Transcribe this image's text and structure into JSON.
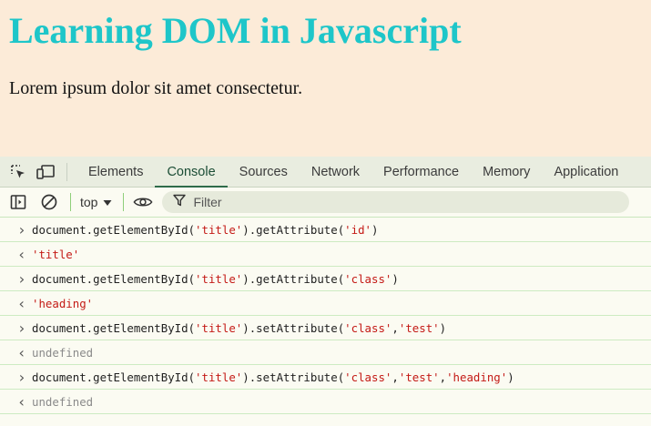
{
  "page": {
    "heading": "Learning DOM in Javascript",
    "paragraph": "Lorem ipsum dolor sit amet consectetur."
  },
  "devtools": {
    "tabs": [
      "Elements",
      "Console",
      "Sources",
      "Network",
      "Performance",
      "Memory",
      "Application"
    ],
    "active_tab": "Console",
    "context_label": "top",
    "filter_placeholder": "Filter",
    "icons": {
      "inspect": "inspect-element-icon",
      "device": "device-toolbar-icon",
      "sidebar": "sidebar-toggle-icon",
      "clear": "clear-console-icon",
      "eye": "live-expression-icon",
      "filter": "filter-icon",
      "dropdown": "chevron-down-icon"
    },
    "console_lines": [
      {
        "kind": "input",
        "prefix": "document.getElementById(",
        "a1": "'title'",
        "mid": ").getAttribute(",
        "a2": "'id'",
        "sep": "",
        "a3": "",
        "sep2": "",
        "a4": "",
        "suffix": ")"
      },
      {
        "kind": "output",
        "value": "'title'"
      },
      {
        "kind": "input",
        "prefix": "document.getElementById(",
        "a1": "'title'",
        "mid": ").getAttribute(",
        "a2": "'class'",
        "sep": "",
        "a3": "",
        "sep2": "",
        "a4": "",
        "suffix": ")"
      },
      {
        "kind": "output",
        "value": "'heading'"
      },
      {
        "kind": "input",
        "prefix": "document.getElementById(",
        "a1": "'title'",
        "mid": ").setAttribute(",
        "a2": "'class'",
        "sep": ",",
        "a3": "'test'",
        "sep2": "",
        "a4": "",
        "suffix": ")"
      },
      {
        "kind": "undefined",
        "value": "undefined"
      },
      {
        "kind": "input",
        "prefix": "document.getElementById(",
        "a1": "'title'",
        "mid": ").setAttribute(",
        "a2": "'class'",
        "sep": ",",
        "a3": "'test'",
        "sep2": ",",
        "a4": "'heading'",
        "suffix": ")"
      },
      {
        "kind": "undefined",
        "value": "undefined"
      }
    ]
  }
}
